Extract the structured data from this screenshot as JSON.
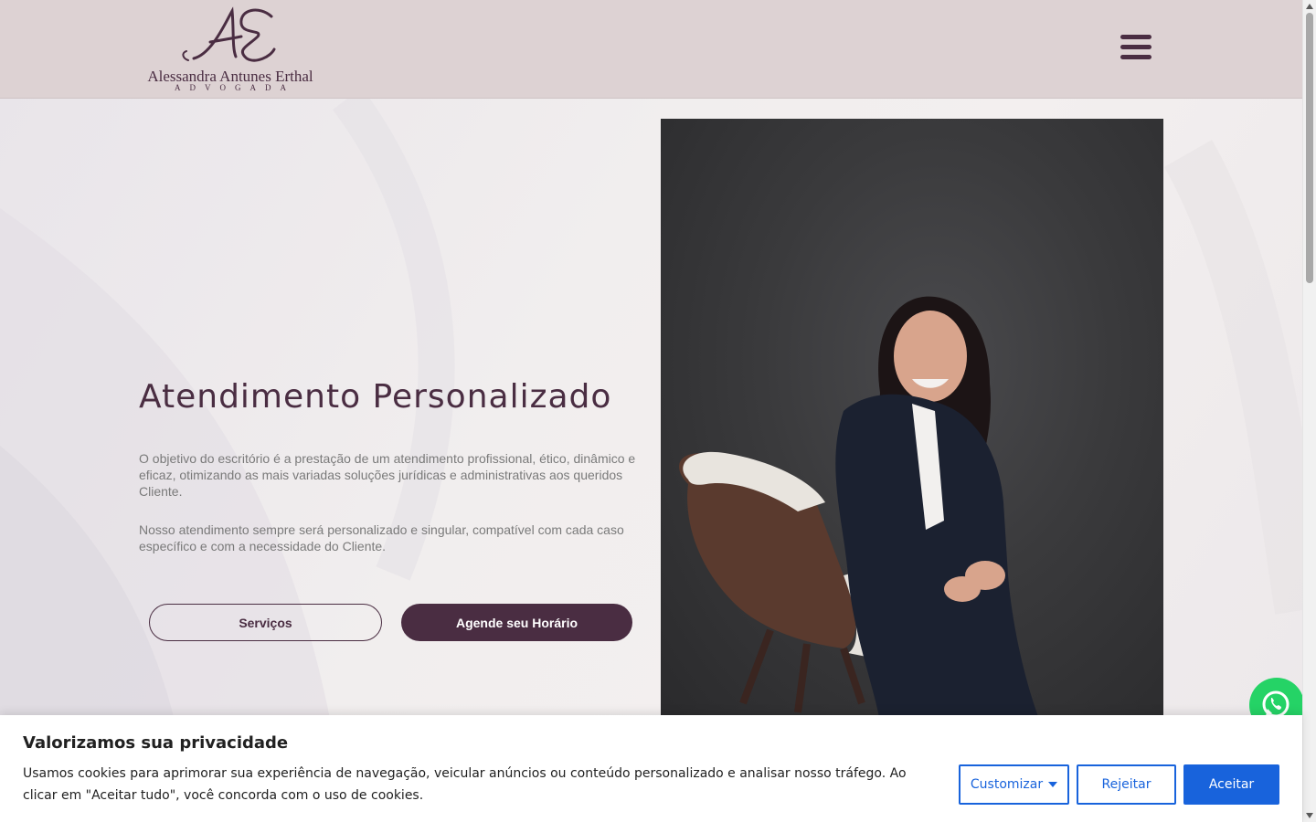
{
  "header": {
    "logo_monogram": "AE",
    "logo_name": "Alessandra Antunes Erthal",
    "logo_subtitle": "ADVOGADA",
    "menu_icon": "hamburger-icon"
  },
  "hero": {
    "title": "Atendimento Personalizado",
    "paragraph1": "O objetivo do escritório é a prestação de um atendimento profissional, ético, dinâmico e eficaz, otimizando as mais variadas soluções jurídicas e administrativas aos queridos Cliente.",
    "paragraph2": "Nosso atendimento sempre será personalizado e singular, compatível com cada caso específico e com a necessidade do Cliente.",
    "btn_services": "Serviços",
    "btn_schedule": "Agende seu Horário",
    "photo_alt": "portrait-photo"
  },
  "whatsapp": {
    "icon": "whatsapp-icon"
  },
  "cookie": {
    "title": "Valorizamos sua privacidade",
    "text": "Usamos cookies para aprimorar sua experiência de navegação, veicular anúncios ou conteúdo personalizado e analisar nosso tráfego. Ao clicar em \"Aceitar tudo\", você concorda com o uso de cookies.",
    "customize": "Customizar",
    "reject": "Rejeitar",
    "accept": "Aceitar"
  },
  "colors": {
    "brand": "#4a2d42",
    "header_bg": "#ddd2d3",
    "cookie_accent": "#1863dc",
    "whatsapp": "#25d366"
  }
}
